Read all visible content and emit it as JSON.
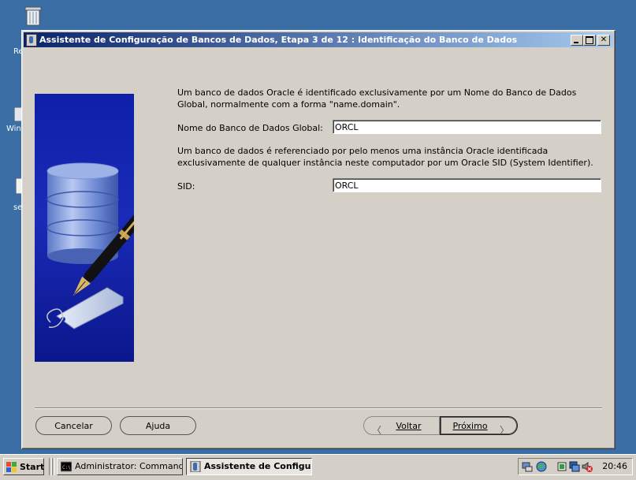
{
  "desktop": {
    "label1": "Re",
    "label2": "Win",
    "label3": "se"
  },
  "window": {
    "title": "Assistente de Configuração de Bancos de Dados, Etapa 3 de 12 : Identificação do Banco de Dados"
  },
  "content": {
    "intro_line1": "Um banco de dados Oracle é identificado exclusivamente por um Nome do Banco de Dados",
    "intro_line2": "Global, normalmente com a forma \"name.domain\".",
    "global_name_label": "Nome do Banco de Dados Global:",
    "global_name_value": "ORCL",
    "sid_desc_line1": "Um banco de dados é referenciado por pelo menos uma instância Oracle identificada",
    "sid_desc_line2": "exclusivamente de qualquer instância neste computador por um Oracle SID (System Identifier).",
    "sid_label": "SID:",
    "sid_value": "ORCL"
  },
  "buttons": {
    "cancel": "Cancelar",
    "help": "Ajuda",
    "back": "Voltar",
    "next": "Próximo"
  },
  "taskbar": {
    "start": "Start",
    "task1": "Administrator: Command...",
    "task2": "Assistente de Configu...",
    "clock": "20:46"
  }
}
